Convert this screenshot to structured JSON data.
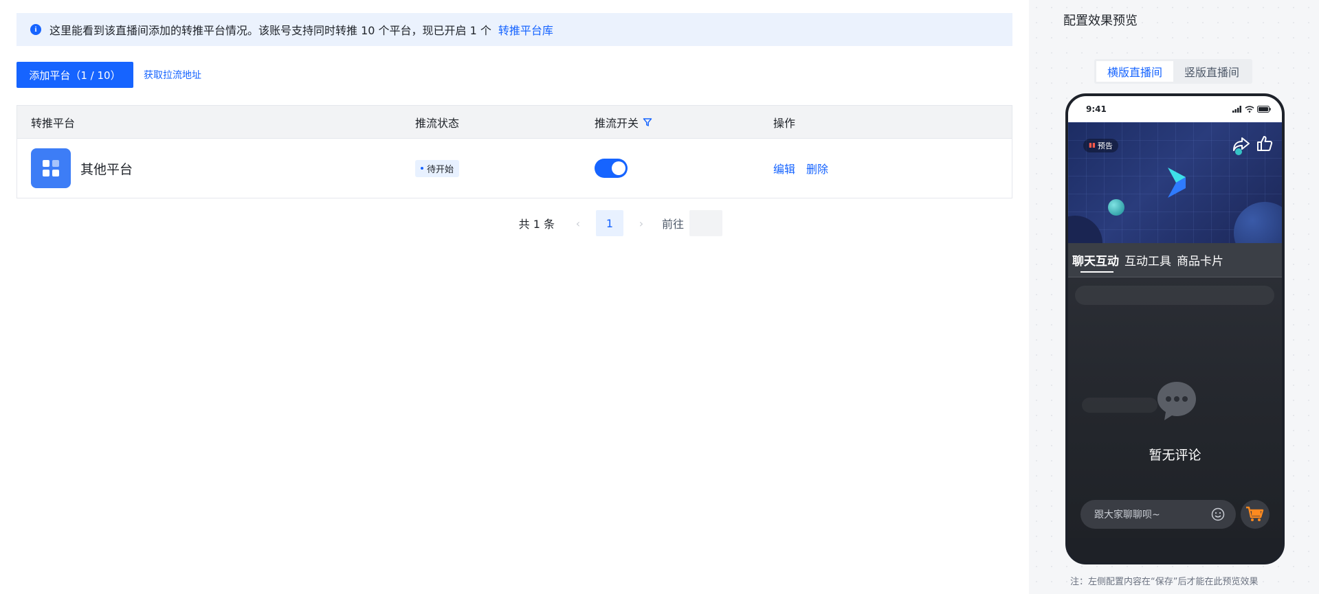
{
  "notice": {
    "text": "这里能看到该直播间添加的转推平台情况。该账号支持同时转推 10 个平台，现已开启 1 个",
    "link": "转推平台库"
  },
  "toolbar": {
    "add_button": "添加平台（1 / 10）",
    "pull_link": "获取拉流地址"
  },
  "table": {
    "headers": [
      "转推平台",
      "推流状态",
      "推流开关",
      "操作"
    ],
    "rows": [
      {
        "platform": "其他平台",
        "status": "待开始",
        "switch_on": true,
        "actions": [
          "编辑",
          "删除"
        ]
      }
    ]
  },
  "pager": {
    "total": "共 1 条",
    "current_page": "1",
    "goto_label": "前往"
  },
  "preview": {
    "title": "配置效果预览",
    "segments": [
      "横版直播间",
      "竖版直播间"
    ],
    "active_segment": 0,
    "phone": {
      "time": "9:41",
      "badge": "预告",
      "tabs": [
        "聊天互动",
        "互动工具",
        "商品卡片"
      ],
      "empty_text": "暂无评论",
      "input_placeholder": "跟大家聊聊呗~"
    },
    "footnote": "注：左侧配置内容在“保存”后才能在此预览效果"
  },
  "colors": {
    "accent": "#1664ff",
    "notice_bg": "#ebf2fd",
    "header_bg": "#f2f3f5",
    "phone_bg": "#1e2127"
  }
}
